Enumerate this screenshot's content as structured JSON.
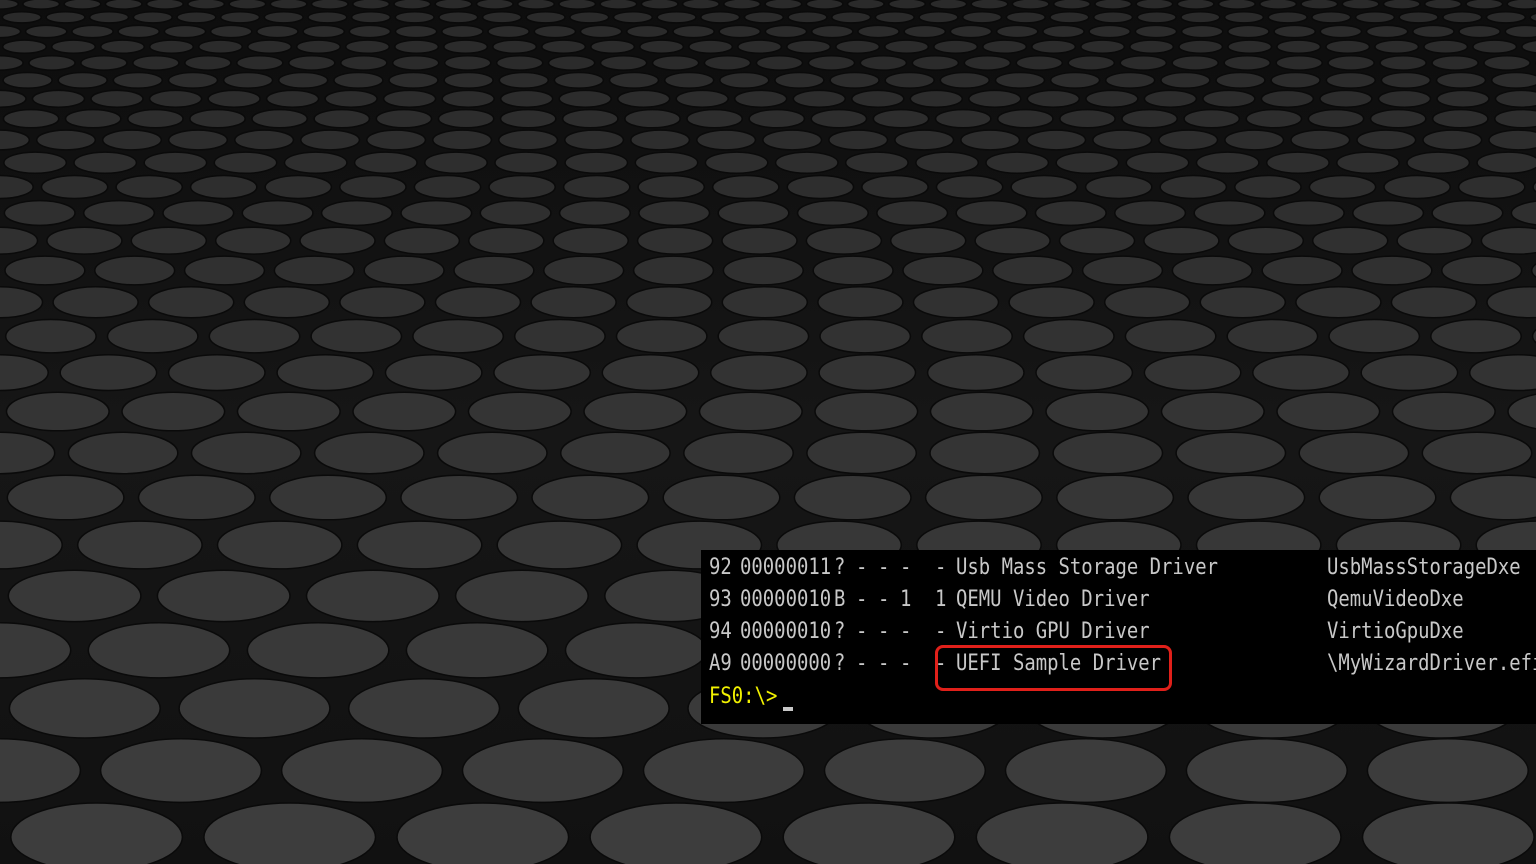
{
  "drivers": [
    {
      "handle": "92",
      "version": "00000011",
      "type": "?",
      "cfg": "-",
      "diag": "-",
      "controllers": "-",
      "children": "-",
      "name": "Usb Mass Storage Driver",
      "image": "UsbMassStorageDxe"
    },
    {
      "handle": "93",
      "version": "00000010",
      "type": "B",
      "cfg": "-",
      "diag": "-",
      "controllers": "1",
      "children": "1",
      "name": "QEMU Video Driver",
      "image": "QemuVideoDxe"
    },
    {
      "handle": "94",
      "version": "00000010",
      "type": "?",
      "cfg": "-",
      "diag": "-",
      "controllers": "-",
      "children": "-",
      "name": "Virtio GPU Driver",
      "image": "VirtioGpuDxe"
    },
    {
      "handle": "A9",
      "version": "00000000",
      "type": "?",
      "cfg": "-",
      "diag": "-",
      "controllers": "-",
      "children": "-",
      "name": "UEFI Sample Driver",
      "image": "\\MyWizardDriver.efi"
    }
  ],
  "prompt": "FS0:\\>",
  "colors": {
    "console_bg": "#000000",
    "console_text": "#c8c8c8",
    "prompt_text": "#f2f200",
    "highlight": "#e0201a",
    "wallpaper": "#1c1c1c"
  },
  "highlight_target": "UEFI Sample Driver"
}
